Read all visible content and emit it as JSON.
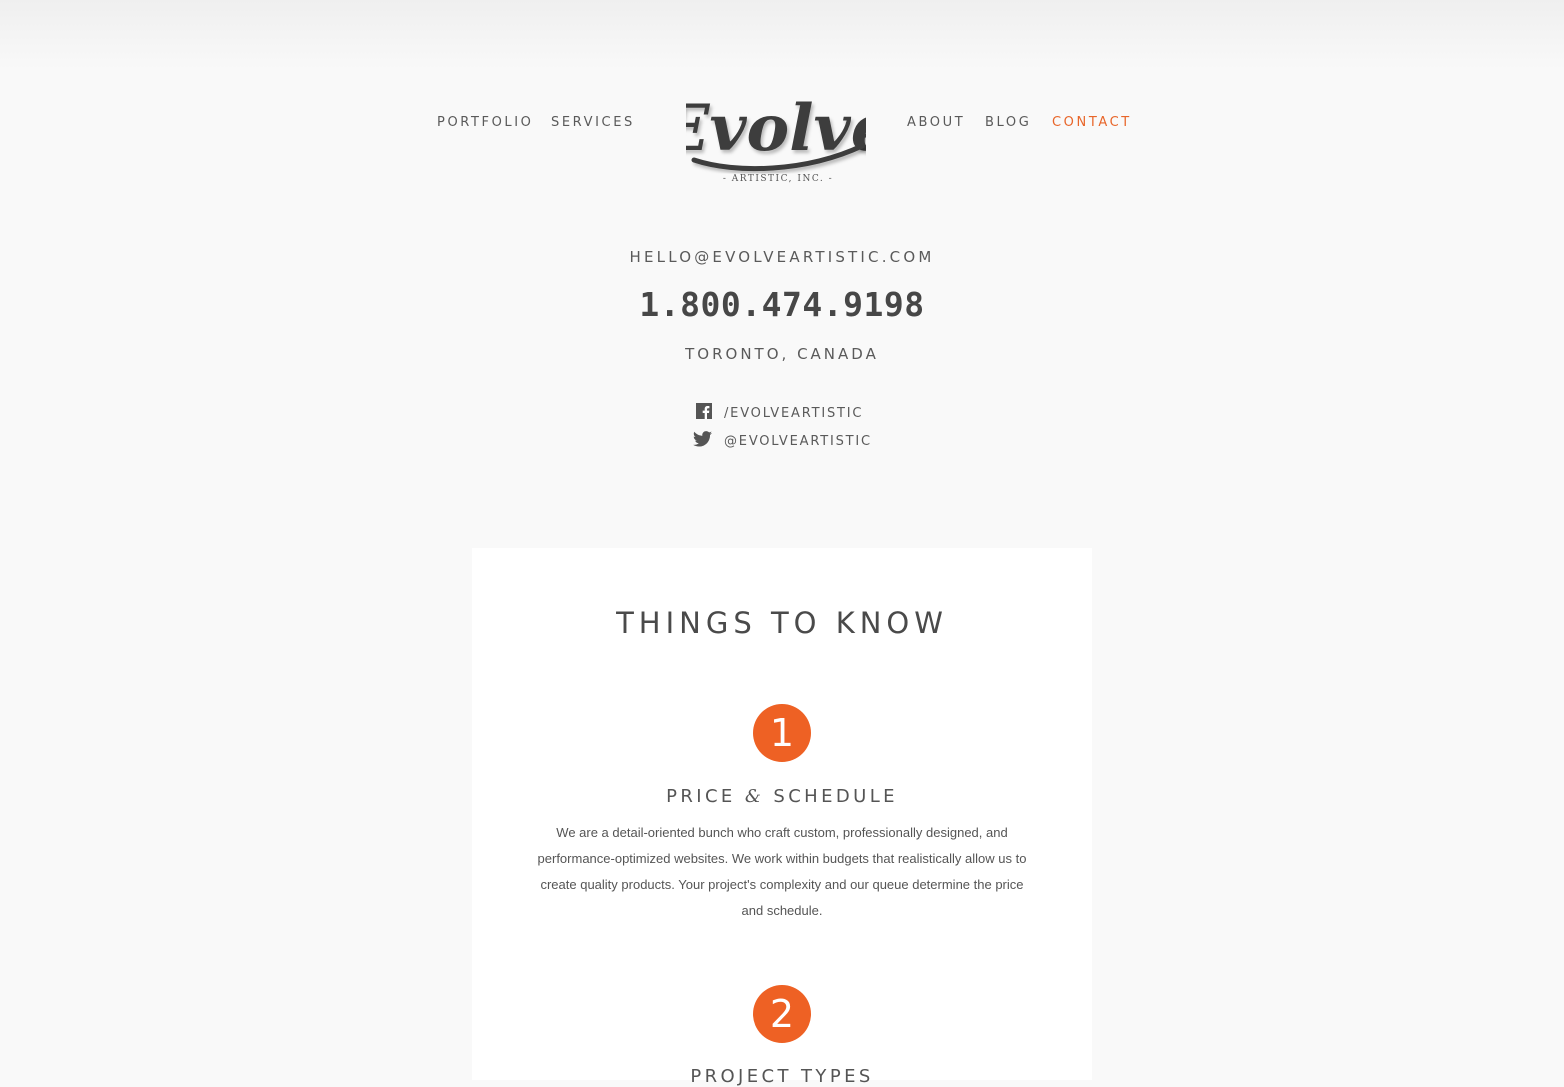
{
  "nav": {
    "left": [
      {
        "label": "PORTFOLIO",
        "active": false
      },
      {
        "label": "SERVICES",
        "active": false
      }
    ],
    "right": [
      {
        "label": "ABOUT",
        "active": false
      },
      {
        "label": "BLOG",
        "active": false
      },
      {
        "label": "CONTACT",
        "active": true
      }
    ]
  },
  "logo": {
    "wordmark": "Evolve",
    "tagline": "- ARTISTIC, INC. -"
  },
  "contact": {
    "email": "HELLO@EVOLVEARTISTIC.COM",
    "phone": "1.800.474.9198",
    "location": "TORONTO, CANADA",
    "facebook": "/EVOLVEARTISTIC",
    "twitter": "@EVOLVEARTISTIC"
  },
  "things": {
    "title": "THINGS TO KNOW",
    "items": [
      {
        "number": "1",
        "title_start": "PRICE ",
        "title_amp": "&",
        "title_end": " SCHEDULE",
        "text": "We are a detail-oriented bunch who craft custom, professionally designed, and performance-optimized websites. We work within budgets that realistically allow us to create quality products. Your project's complexity and our queue determine the price and schedule."
      },
      {
        "number": "2",
        "title": "PROJECT TYPES"
      }
    ]
  },
  "colors": {
    "accent": "#ee6124",
    "nav_active": "#e8662a",
    "background": "#f9f9f9",
    "card": "#ffffff",
    "text": "#4a4a4a"
  },
  "icons": {
    "facebook": "facebook-icon",
    "twitter": "twitter-icon"
  }
}
